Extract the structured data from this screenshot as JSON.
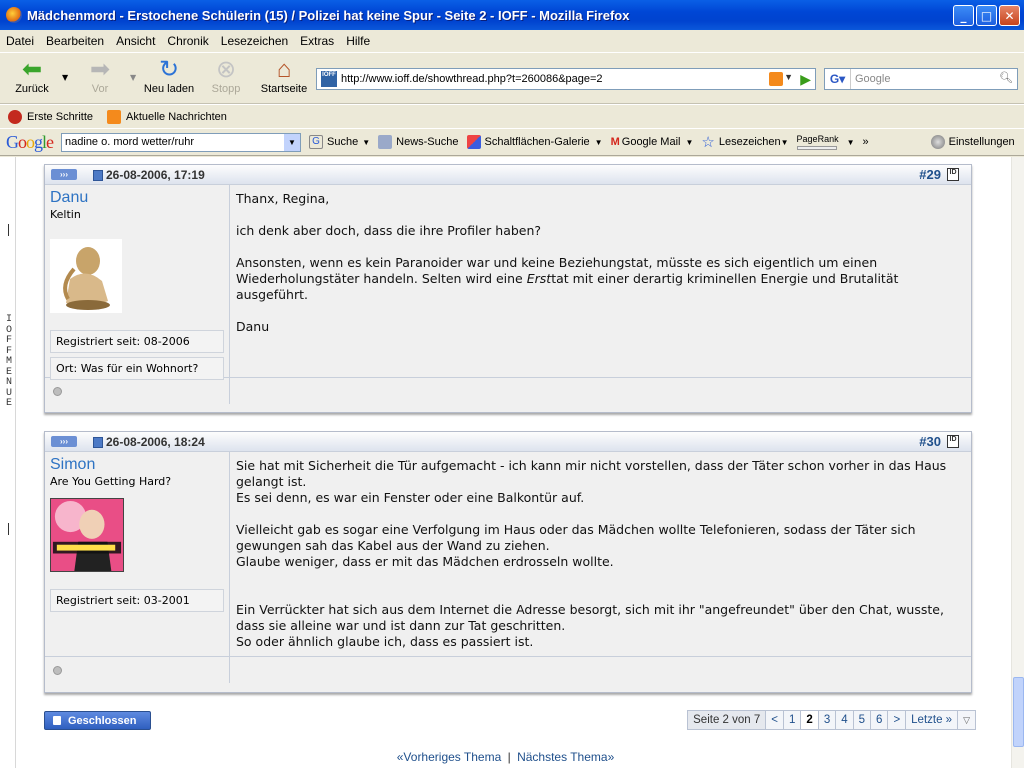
{
  "window": {
    "title": "Mädchenmord - Erstochene Schülerin (15) / Polizei hat keine Spur - Seite 2 - IOFF - Mozilla Firefox"
  },
  "menu": [
    "Datei",
    "Bearbeiten",
    "Ansicht",
    "Chronik",
    "Lesezeichen",
    "Extras",
    "Hilfe"
  ],
  "nav": {
    "back": "Zurück",
    "forward": "Vor",
    "reload": "Neu laden",
    "stop": "Stopp",
    "home": "Startseite",
    "url": "http://www.ioff.de/showthread.php?t=260086&page=2",
    "url_favicon_text": "IOFF",
    "search_placeholder": "Google"
  },
  "bookmarks": [
    "Erste Schritte",
    "Aktuelle Nachrichten"
  ],
  "google_bar": {
    "logo": "Google",
    "query": "nadine o. mord wetter/ruhr",
    "search": "Suche",
    "news": "News-Suche",
    "gallery": "Schaltflächen-Galerie",
    "mail": "Google Mail",
    "bookmarks": "Lesezeichen",
    "pagerank": "PageRank",
    "more": "»",
    "settings": "Einstellungen"
  },
  "sidebar_menu": "IOFF MENUE",
  "posts": [
    {
      "date": "26-08-2006, 17:19",
      "number": "#29",
      "user": "Danu",
      "user_title": "Keltin",
      "registered": "Registriert seit: 08-2006",
      "location": "Ort: Was für ein Wohnort?",
      "p1": "Thanx, Regina,",
      "p2": "ich denk aber doch, dass die ihre Profiler haben?",
      "p3a": "Ansonsten, wenn es kein Paranoider war und keine Beziehungstat, müsste es sich eigentlich um einen Wiederholungstäter handeln. Selten wird eine ",
      "p3em": "Erst",
      "p3b": "tat mit einer derartig kriminellen Energie und Brutalität ausgeführt.",
      "p4": "Danu"
    },
    {
      "date": "26-08-2006, 18:24",
      "number": "#30",
      "user": "Simon",
      "user_title": "Are You Getting Hard?",
      "registered": "Registriert seit: 03-2001",
      "l1": "Sie hat mit Sicherheit die Tür aufgemacht - ich kann mir nicht vorstellen, dass der Täter schon vorher in das Haus gelangt ist.",
      "l2": "Es sei denn, es war ein Fenster oder eine Balkontür auf.",
      "l3": "Vielleicht gab es sogar eine Verfolgung im Haus oder das Mädchen wollte Telefonieren, sodass der Täter sich gewungen sah das Kabel aus der Wand zu ziehen.",
      "l4": "Glaube weniger, dass er mit das Mädchen erdrosseln wollte.",
      "l5": "Ein Verrückter hat sich aus dem Internet die Adresse besorgt, sich mit ihr \"angefreundet\" über den Chat, wusste, dass sie alleine war und ist dann zur Tat geschritten.",
      "l6": "So oder ähnlich glaube ich, dass es passiert ist."
    }
  ],
  "closed_button": "Geschlossen",
  "pager": {
    "label": "Seite 2 von 7",
    "prev": "<",
    "pages": [
      "1",
      "2",
      "3",
      "4",
      "5",
      "6"
    ],
    "current": "2",
    "next": ">",
    "last": "Letzte »"
  },
  "bottom_nav": {
    "prev": "«Vorheriges Thema",
    "sep": "|",
    "next": "Nächstes Thema»"
  },
  "colors": {
    "titlebar": "#0046d5",
    "link": "#20508c",
    "username": "#2e73c3"
  }
}
